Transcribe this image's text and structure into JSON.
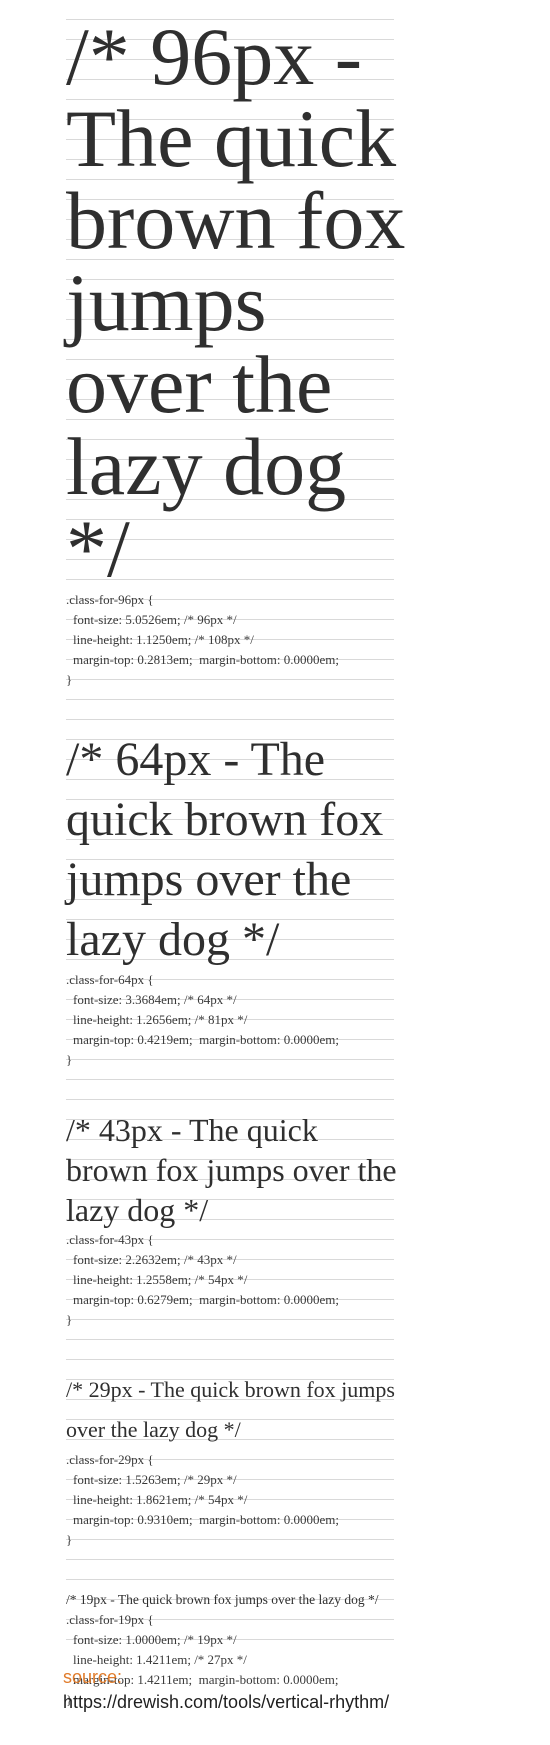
{
  "samples": [
    {
      "heading": "/* 96px - The quick brown fox jumps over the lazy dog */",
      "code": [
        ".class-for-96px {",
        "font-size: 5.0526em; /* 96px */",
        "line-height: 1.1250em; /* 108px */",
        "margin-top: 0.2813em;  margin-bottom: 0.0000em;",
        "}"
      ]
    },
    {
      "heading": "/* 64px - The quick brown fox jumps over the lazy dog */",
      "code": [
        ".class-for-64px {",
        "font-size: 3.3684em; /* 64px */",
        "line-height: 1.2656em; /* 81px */",
        "margin-top: 0.4219em;  margin-bottom: 0.0000em;",
        "}"
      ]
    },
    {
      "heading": "/* 43px - The quick brown fox jumps over the lazy dog */",
      "code": [
        ".class-for-43px {",
        "font-size: 2.2632em; /* 43px */",
        "line-height: 1.2558em; /* 54px */",
        "margin-top: 0.6279em;  margin-bottom: 0.0000em;",
        "}"
      ]
    },
    {
      "heading": "/* 29px - The quick brown fox jumps over the lazy dog */",
      "code": [
        ".class-for-29px {",
        "font-size: 1.5263em; /* 29px */",
        "line-height: 1.8621em; /* 54px */",
        "margin-top: 0.9310em;  margin-bottom: 0.0000em;",
        "}"
      ]
    },
    {
      "heading": "/* 19px - The quick brown fox jumps over the lazy dog */",
      "code": [
        ".class-for-19px {",
        "font-size: 1.0000em; /* 19px */",
        "line-height: 1.4211em; /* 27px */",
        "margin-top: 1.4211em;  margin-bottom: 0.0000em;",
        "}"
      ]
    }
  ],
  "source": {
    "label": "source:",
    "url": "https://drewish.com/tools/vertical-rhythm/"
  }
}
